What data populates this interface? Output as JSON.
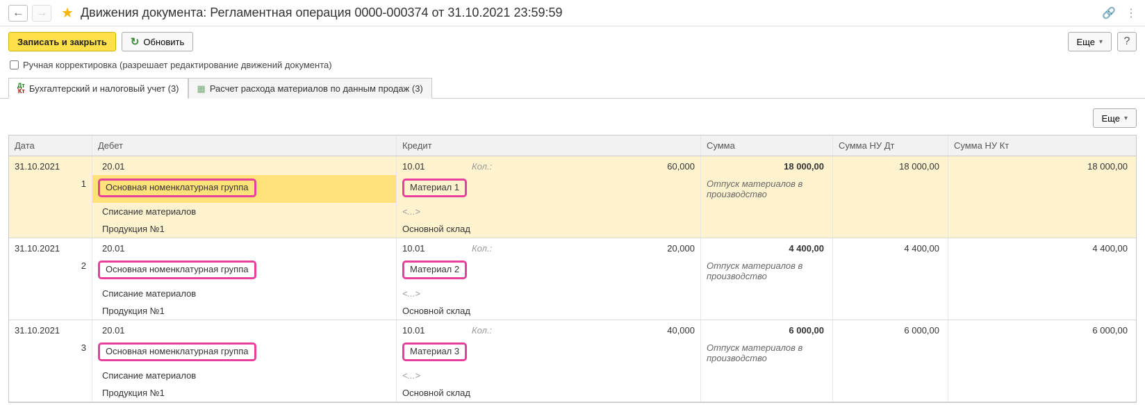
{
  "header": {
    "title": "Движения документа: Регламентная операция 0000-000374 от 31.10.2021 23:59:59"
  },
  "toolbar": {
    "save_close": "Записать и закрыть",
    "refresh": "Обновить",
    "more": "Еще",
    "help": "?"
  },
  "manual_edit": {
    "label": "Ручная корректировка (разрешает редактирование движений документа)",
    "checked": false
  },
  "tabs": [
    {
      "label": "Бухгалтерский и налоговый учет (3)",
      "active": true
    },
    {
      "label": "Расчет расхода материалов по данным продаж (3)",
      "active": false
    }
  ],
  "columns": {
    "date": "Дата",
    "debit": "Дебет",
    "credit": "Кредит",
    "sum": "Сумма",
    "nu_dt": "Сумма НУ Дт",
    "nu_kt": "Сумма НУ Кт"
  },
  "qty_label": "Кол.:",
  "ellipsis": "<...>",
  "rows": [
    {
      "n": "1",
      "date": "31.10.2021",
      "debit_acc": "20.01",
      "debit_group": "Основная номенклатурная группа",
      "debit_line3": "Списание материалов",
      "debit_line4": "Продукция №1",
      "credit_acc": "10.01",
      "credit_item": "Материал 1",
      "credit_line4": "Основной склад",
      "qty": "60,000",
      "sum": "18 000,00",
      "nu_dt": "18 000,00",
      "nu_kt": "18 000,00",
      "desc": "Отпуск материалов в производство",
      "selected": true
    },
    {
      "n": "2",
      "date": "31.10.2021",
      "debit_acc": "20.01",
      "debit_group": "Основная номенклатурная группа",
      "debit_line3": "Списание материалов",
      "debit_line4": "Продукция №1",
      "credit_acc": "10.01",
      "credit_item": "Материал 2",
      "credit_line4": "Основной склад",
      "qty": "20,000",
      "sum": "4 400,00",
      "nu_dt": "4 400,00",
      "nu_kt": "4 400,00",
      "desc": "Отпуск материалов в производство",
      "selected": false
    },
    {
      "n": "3",
      "date": "31.10.2021",
      "debit_acc": "20.01",
      "debit_group": "Основная номенклатурная группа",
      "debit_line3": "Списание материалов",
      "debit_line4": "Продукция №1",
      "credit_acc": "10.01",
      "credit_item": "Материал 3",
      "credit_line4": "Основной склад",
      "qty": "40,000",
      "sum": "6 000,00",
      "nu_dt": "6 000,00",
      "nu_kt": "6 000,00",
      "desc": "Отпуск материалов в производство",
      "selected": false
    }
  ]
}
